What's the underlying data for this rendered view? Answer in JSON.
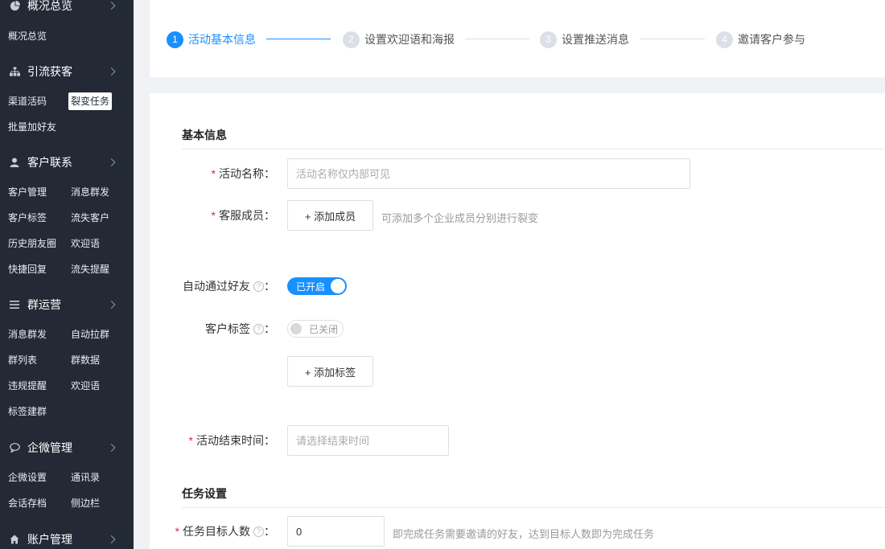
{
  "sidebar": {
    "groups": [
      {
        "title": "概况总览",
        "icon": "pie-chart-icon",
        "items": [
          "概况总览"
        ]
      },
      {
        "title": "引流获客",
        "icon": "sitemap-icon",
        "items": [
          "渠道活码",
          "裂变任务",
          "批量加好友"
        ]
      },
      {
        "title": "客户联系",
        "icon": "user-icon",
        "items": [
          "客户管理",
          "消息群发",
          "客户标签",
          "流失客户",
          "历史朋友圈",
          "欢迎语",
          "快捷回复",
          "流失提醒"
        ]
      },
      {
        "title": "群运营",
        "icon": "menu-lines-icon",
        "items": [
          "消息群发",
          "自动拉群",
          "群列表",
          "群数据",
          "违规提醒",
          "欢迎语",
          "标签建群"
        ]
      },
      {
        "title": "企微管理",
        "icon": "chat-bubble-icon",
        "items": [
          "企微设置",
          "通讯录",
          "会话存档",
          "侧边栏"
        ]
      },
      {
        "title": "账户管理",
        "icon": "home-icon",
        "items": []
      }
    ],
    "active_item": "裂变任务"
  },
  "steps": [
    {
      "num": "1",
      "label": "活动基本信息",
      "active": true
    },
    {
      "num": "2",
      "label": "设置欢迎语和海报",
      "active": false
    },
    {
      "num": "3",
      "label": "设置推送消息",
      "active": false
    },
    {
      "num": "4",
      "label": "邀请客户参与",
      "active": false
    }
  ],
  "form": {
    "basic_title": "基本信息",
    "activity_name": {
      "label": "活动名称",
      "placeholder": "活动名称仅内部可见",
      "value": ""
    },
    "staff": {
      "label": "客服成员",
      "button": "+ 添加成员",
      "hint": "可添加多个企业成员分别进行裂变"
    },
    "auto_accept": {
      "label": "自动通过好友",
      "switch_text": "已开启",
      "on": true
    },
    "customer_tag": {
      "label": "客户标签",
      "switch_text": "已关闭",
      "on": false,
      "button": "+ 添加标签"
    },
    "end_time": {
      "label": "活动结束时间",
      "placeholder": "请选择结束时间"
    },
    "task_title": "任务设置",
    "target_count": {
      "label": "任务目标人数",
      "value": "0",
      "hint": "即完成任务需要邀请的好友，达到目标人数即为完成任务"
    },
    "colon": "："
  },
  "colors": {
    "accent": "#1890ff",
    "sidebar_bg": "#232a36",
    "required": "#f5222d"
  }
}
